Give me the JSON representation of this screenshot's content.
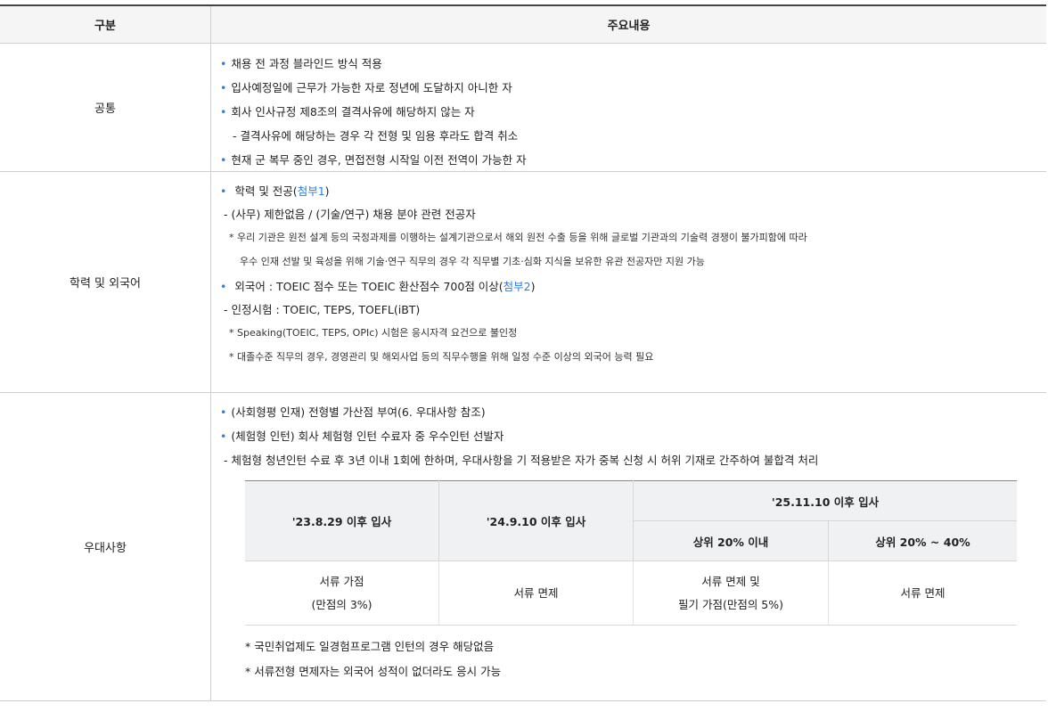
{
  "header": {
    "col1": "구분",
    "col2": "주요내용"
  },
  "rows": [
    {
      "category": "공통",
      "lines": [
        {
          "type": "bullet",
          "text": "채용 전 과정 블라인드 방식 적용"
        },
        {
          "type": "bullet",
          "text": "입사예정일에 근무가 가능한 자로 정년에 도달하지 아니한 자"
        },
        {
          "type": "bullet",
          "text": "회사 인사규정 제8조의 결격사유에 해당하지 않는 자"
        },
        {
          "type": "sub",
          "text": " - 결격사유에 해당하는 경우 각 전형 및 임용 후라도 합격 취소"
        },
        {
          "type": "bullet",
          "text": "현재 군 복무 중인 경우, 면접전형 시작일 이전 전역이 가능한 자"
        }
      ]
    },
    {
      "category": "학력 및 외국어",
      "lines": [
        {
          "type": "bullet",
          "text": "학력 및 전공(",
          "link": "첨부1",
          "after": ")"
        },
        {
          "type": "sub",
          "text": "- (사무) 제한없음 / (기술/연구) 채용 분야 관련 전공자"
        },
        {
          "type": "note",
          "text": "* 우리 기관은 원전 설계 등의 국정과제를 이행하는 설계기관으로서 해외 원전 수출 등을 위해 글로벌 기관과의 기술력 경쟁이 불가피함에 따라"
        },
        {
          "type": "note",
          "text": "   우수 인재 선발 및 육성을 위해 기술·연구 직무의 경우 각 직무별 기초·심화 지식을 보유한 유관 전공자만 지원 가능"
        },
        {
          "type": "bullet",
          "text": "외국어 : TOEIC 점수 또는 TOEIC 환산점수 700점 이상(",
          "link": "첨부2",
          "after": ")"
        },
        {
          "type": "sub",
          "text": "- 인정시험 : TOEIC, TEPS, TOEFL(iBT)"
        },
        {
          "type": "note",
          "text": "* Speaking(TOEIC, TEPS, OPIc) 시험은 응시자격 요건으로 불인정"
        },
        {
          "type": "note",
          "text": "* 대졸수준 직무의 경우, 경영관리 및 해외사업 등의 직무수행을 위해 일정 수준 이상의 외국어 능력 필요"
        }
      ]
    },
    {
      "category": "우대사항",
      "lines": [
        {
          "type": "bullet",
          "text": "(사회형평 인재) 전형별 가산점 부여(6. 우대사항 참조)"
        },
        {
          "type": "bullet",
          "text": "(체험형 인턴) 회사 체험형 인턴 수료자 중 우수인턴 선발자"
        },
        {
          "type": "sub",
          "text": "- 체험형 청년인턴 수료 후 3년 이내 1회에 한하며, 우대사항을 기 적용받은 자가 중복 신청 시 허위 기재로 간주하여 불합격 처리"
        }
      ],
      "table": {
        "h_2023": "'23.8.29 이후 입사",
        "h_2024": "'24.9.10 이후 입사",
        "h_2025": "'25.11.10 이후 입사",
        "h_top20": "상위 20% 이내",
        "h_top40": "상위 20% ~ 40%",
        "c_2023_a": "서류 가점",
        "c_2023_b": "(만점의 3%)",
        "c_2024": "서류 면제",
        "c_top20_a": "서류 면제 및",
        "c_top20_b": "필기 가점(만점의 5%)",
        "c_top40": "서류 면제"
      },
      "notes": [
        "* 국민취업제도 일경험프로그램 인턴의 경우 해당없음",
        "* 서류전형 면제자는 외국어 성적이 없더라도 응시 가능"
      ]
    }
  ],
  "colors": {
    "accent": "#2f7de1",
    "header_bg": "#f5f5f5",
    "inner_header_bg": "#f0f1f3"
  }
}
